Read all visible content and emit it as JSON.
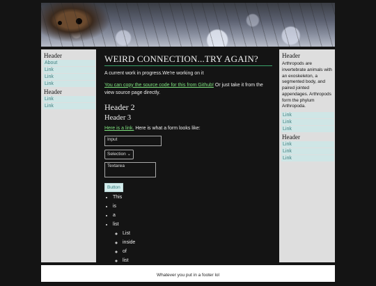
{
  "left_sidebar": {
    "header1": "Header",
    "links1": [
      "About",
      "Link",
      "Link",
      "Link"
    ],
    "header2": "Header",
    "links2": [
      "Link",
      "Link"
    ]
  },
  "main": {
    "title": "WEIRD CONNECTION...TRY AGAIN?",
    "intro": "A current work in progress.We're working on it",
    "source_link": "You can copy the source code for this from Github!",
    "source_rest": " Or just take it from the view source page directly.",
    "header2": "Header 2",
    "header3": "Header 3",
    "form_link": "Here is a link.",
    "form_intro": " Here is what a form looks like:",
    "input_value": "Input",
    "select_value": "Selection",
    "textarea_value": "Textarea",
    "button_label": "Button",
    "list": [
      "This",
      "is",
      "a",
      "list"
    ],
    "sublist": [
      "List",
      "inside",
      "of",
      "list"
    ]
  },
  "right_sidebar": {
    "header1": "Header",
    "paragraph": "Arthropods are invertebrate animals with an exoskeleton, a segmented body, and paired jointed appendages. Arthropods form the phylum Arthropoda.",
    "links1": [
      "Link",
      "Link",
      "Link"
    ],
    "header2": "Header",
    "links2": [
      "Link",
      "Link",
      "Link"
    ]
  },
  "footer": {
    "text": "Whatever you put in a footer lol"
  }
}
